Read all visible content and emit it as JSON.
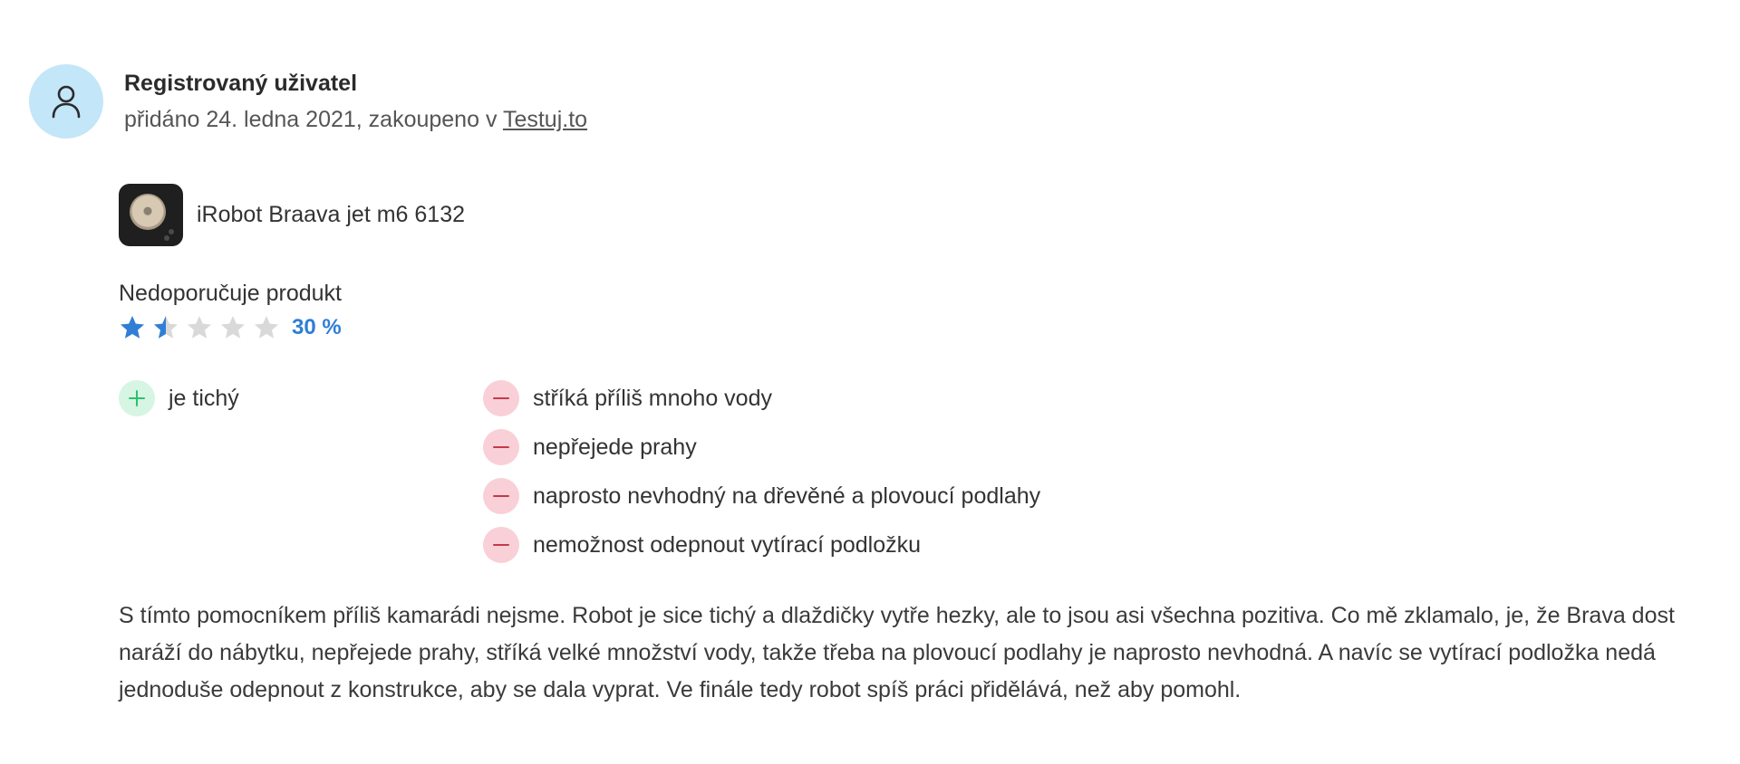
{
  "author": {
    "name": "Registrovaný uživatel",
    "added_prefix": "přidáno 24. ledna 2021, zakoupeno v ",
    "shop_link": "Testuj.to",
    "avatar_icon": "user-icon"
  },
  "product": {
    "name": "iRobot Braava jet m6 6132",
    "thumbnail": "robot-mop-image"
  },
  "verdict": "Nedoporučuje produkt",
  "rating": {
    "percent_label": "30 %",
    "stars_total": 5,
    "stars_value": 1.5,
    "color_filled": "#2f7fd6",
    "color_empty": "#d9d9d9"
  },
  "pros": [
    "je tichý"
  ],
  "cons": [
    "stříká příliš mnoho vody",
    "nepřejede prahy",
    "naprosto nevhodný na dřevěné a plovoucí podlahy",
    "nemožnost odepnout vytírací podložku"
  ],
  "colors": {
    "plus_bg": "#d6f5e3",
    "plus_fg": "#2fbf6b",
    "minus_bg": "#f9d0d7",
    "minus_fg": "#c23a4a",
    "avatar_bg": "#c3e6f8"
  },
  "review_text": "S tímto pomocníkem příliš kamarádi nejsme. Robot je sice tichý a dlaždičky vytře hezky, ale to jsou asi všechna pozitiva. Co mě zklamalo, je, že Brava dost naráží do nábytku, nepřejede prahy, stříká velké množství vody, takže třeba na plovoucí podlahy je naprosto nevhodná. A navíc se vytírací podložka nedá jednoduše odepnout z konstrukce, aby se dala vyprat. Ve finále tedy robot spíš práci přidělává, než aby pomohl."
}
